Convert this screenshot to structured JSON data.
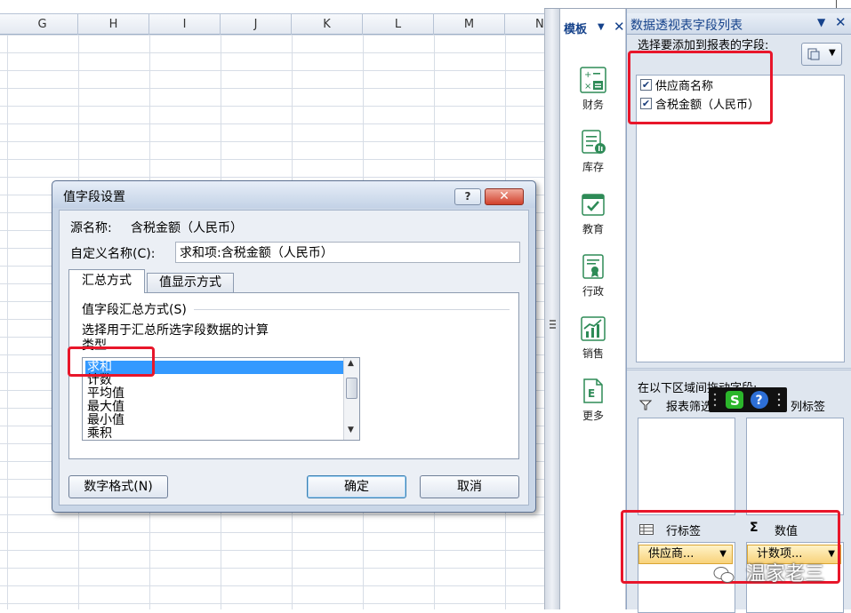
{
  "sheet": {
    "columns": [
      "G",
      "H",
      "I",
      "J",
      "K",
      "L",
      "M",
      "N"
    ]
  },
  "templates_pane": {
    "title": "模板",
    "items": [
      {
        "label": "财务",
        "icon": "calculator-icon"
      },
      {
        "label": "库存",
        "icon": "inventory-icon"
      },
      {
        "label": "教育",
        "icon": "education-icon"
      },
      {
        "label": "行政",
        "icon": "certificate-icon"
      },
      {
        "label": "销售",
        "icon": "sales-chart-icon"
      },
      {
        "label": "更多",
        "icon": "more-templates-icon"
      }
    ]
  },
  "pivot": {
    "title": "数据透视表字段列表",
    "prompt": "选择要添加到报表的字段:",
    "fields": [
      {
        "label": "供应商名称",
        "checked": true
      },
      {
        "label": "含税金额（人民币）",
        "checked": true
      }
    ],
    "drag_prompt": "在以下区域间拖动字段:",
    "filter_label": "报表筛选",
    "column_label": "列标签",
    "row_label": "行标签",
    "values_label": "数值",
    "row_pill": "供应商...",
    "value_pill": "计数项..."
  },
  "dialog": {
    "title": "值字段设置",
    "help": "?",
    "close": "✕",
    "source_label": "源名称:",
    "source_value": "含税金额（人民币）",
    "custom_name_label": "自定义名称(C):",
    "custom_name_value": "求和项:含税金额（人民币）",
    "tabs": [
      "汇总方式",
      "值显示方式"
    ],
    "group_label": "值字段汇总方式(S)",
    "group_desc": "选择用于汇总所选字段数据的计算类型",
    "functions": [
      "求和",
      "计数",
      "平均值",
      "最大值",
      "最小值",
      "乘积"
    ],
    "selected_function": "求和",
    "buttons": {
      "number_format": "数字格式(N)",
      "ok": "确定",
      "cancel": "取消"
    }
  },
  "watermark": "温家老三",
  "colors": {
    "highlight": "#e8162a",
    "selection": "#3399ff",
    "pane_title": "#15428b"
  }
}
